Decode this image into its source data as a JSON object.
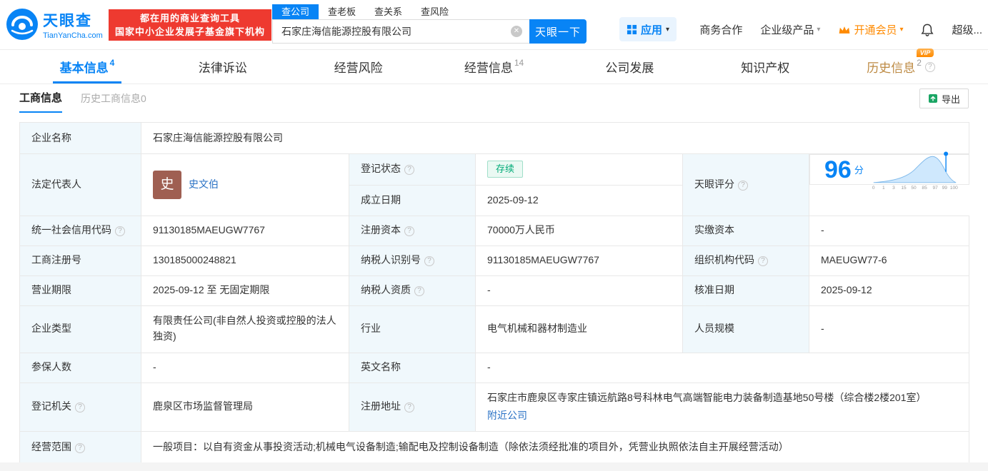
{
  "colors": {
    "primary_blue": "#0884f5",
    "brand_red": "#ee3a30",
    "vip_orange": "#ff8a00",
    "history_gold": "#bd8a43",
    "status_green": "#00ab77",
    "label_bg": "#f0f8fc",
    "link_blue": "#2a72c5"
  },
  "icons": {
    "caret": "▾",
    "clear": "✕"
  },
  "header": {
    "brand": {
      "name": "天眼查",
      "domain": "TianYanCha.com"
    },
    "slogan": {
      "line1": "都在用的商业查询工具",
      "line2": "国家中小企业发展子基金旗下机构"
    },
    "search_tabs": [
      {
        "label": "查公司",
        "active": true
      },
      {
        "label": "查老板",
        "active": false
      },
      {
        "label": "查关系",
        "active": false
      },
      {
        "label": "查风险",
        "active": false
      }
    ],
    "search": {
      "value": "石家庄海信能源控股有限公司",
      "button_label": "天眼一下"
    },
    "apps_label": "应用",
    "nav": {
      "cooperation": "商务合作",
      "enterprise": "企业级产品",
      "vip": "开通会员",
      "super": "超级..."
    }
  },
  "tabs": [
    {
      "label": "基本信息",
      "count": "4"
    },
    {
      "label": "法律诉讼",
      "count": ""
    },
    {
      "label": "经营风险",
      "count": ""
    },
    {
      "label": "经营信息",
      "count": "14"
    },
    {
      "label": "公司发展",
      "count": ""
    },
    {
      "label": "知识产权",
      "count": ""
    },
    {
      "label": "历史信息",
      "count": "2",
      "badge": "VIP"
    }
  ],
  "subtabs": {
    "active": "工商信息",
    "inactive": "历史工商信息",
    "inactive_count": "0",
    "export_label": "导出"
  },
  "table": {
    "company_name": {
      "label": "企业名称",
      "value": "石家庄海信能源控股有限公司"
    },
    "legal_rep": {
      "label": "法定代表人",
      "name": "史文伯",
      "avatar_char": "史"
    },
    "reg_status": {
      "label": "登记状态",
      "value": "存续"
    },
    "est_date": {
      "label": "成立日期",
      "value": "2025-09-12"
    },
    "score": {
      "label": "天眼评分",
      "value": "96",
      "unit": "分",
      "axis": [
        "0",
        "1",
        "3",
        "15",
        "50",
        "85",
        "97",
        "99",
        "100"
      ]
    },
    "credit_code": {
      "label": "统一社会信用代码",
      "value": "91130185MAEUGW7767"
    },
    "reg_capital": {
      "label": "注册资本",
      "value": "70000万人民币"
    },
    "paid_capital": {
      "label": "实缴资本",
      "value": "-"
    },
    "reg_number": {
      "label": "工商注册号",
      "value": "130185000248821"
    },
    "taxpayer_id": {
      "label": "纳税人识别号",
      "value": "91130185MAEUGW7767"
    },
    "org_code": {
      "label": "组织机构代码",
      "value": "MAEUGW77-6"
    },
    "business_term": {
      "label": "营业期限",
      "value": "2025-09-12 至 无固定期限"
    },
    "taxpayer_quality": {
      "label": "纳税人资质",
      "value": "-"
    },
    "approval_date": {
      "label": "核准日期",
      "value": "2025-09-12"
    },
    "company_type": {
      "label": "企业类型",
      "value": "有限责任公司(非自然人投资或控股的法人独资)"
    },
    "industry": {
      "label": "行业",
      "value": "电气机械和器材制造业"
    },
    "staff_size": {
      "label": "人员规模",
      "value": "-"
    },
    "insured_count": {
      "label": "参保人数",
      "value": "-"
    },
    "english_name": {
      "label": "英文名称",
      "value": "-"
    },
    "reg_authority": {
      "label": "登记机关",
      "value": "鹿泉区市场监督管理局"
    },
    "reg_address": {
      "label": "注册地址",
      "value": "石家庄市鹿泉区寺家庄镇远航路8号科林电气高端智能电力装备制造基地50号楼（综合楼2楼201室）",
      "link": "附近公司"
    },
    "business_scope": {
      "label": "经营范围",
      "value": "一般项目：以自有资金从事投资活动;机械电气设备制造;输配电及控制设备制造（除依法须经批准的项目外，凭营业执照依法自主开展经营活动）"
    }
  }
}
